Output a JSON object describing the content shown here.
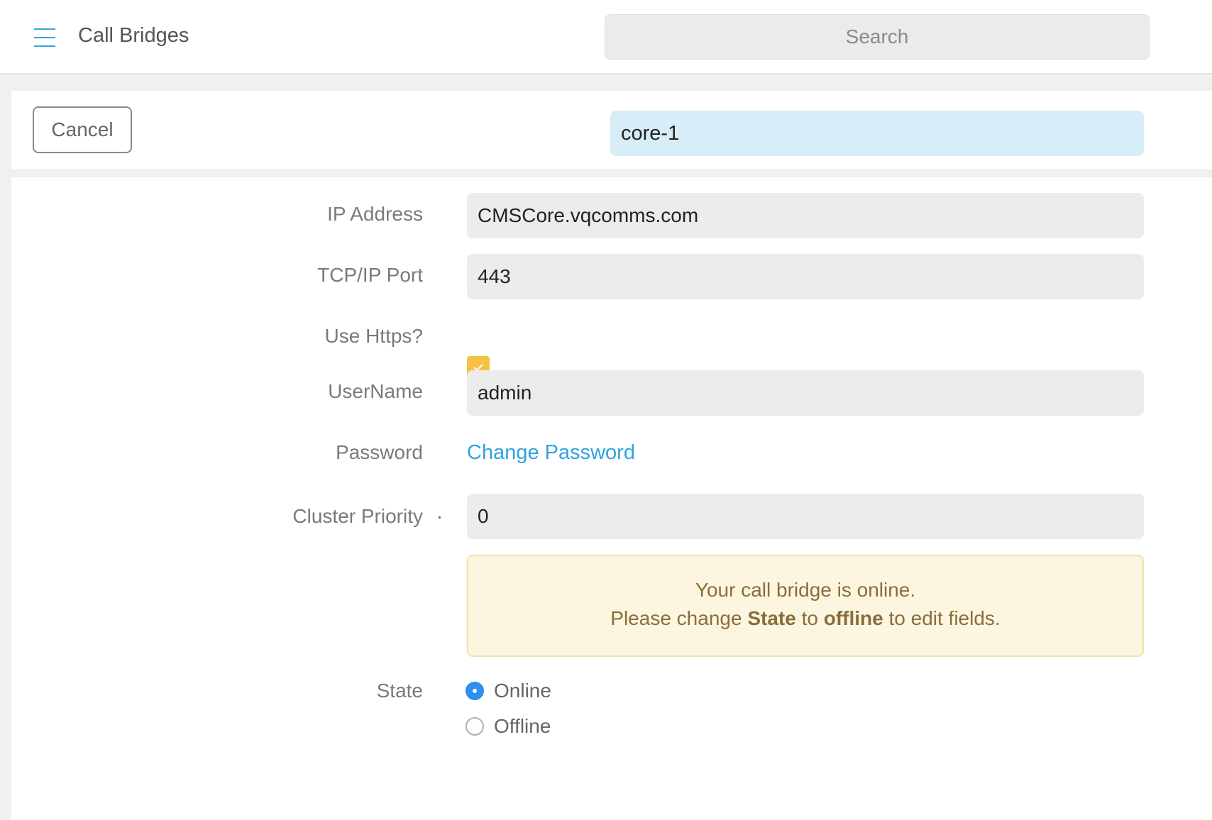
{
  "header": {
    "menu_icon": "hamburger-menu-icon",
    "title": "Call Bridges",
    "search_placeholder": "Search"
  },
  "actions": {
    "cancel_label": "Cancel",
    "name_value": "core-1"
  },
  "form": {
    "ip_address": {
      "label": "IP Address",
      "value": "CMSCore.vqcomms.com"
    },
    "tcp_port": {
      "label": "TCP/IP Port",
      "value": "443"
    },
    "use_https": {
      "label": "Use Https?",
      "checked": true
    },
    "username": {
      "label": "UserName",
      "value": "admin"
    },
    "password": {
      "label": "Password",
      "link": "Change Password"
    },
    "cluster_priority": {
      "label": "Cluster Priority",
      "value": "0"
    },
    "alert": {
      "line1": "Your call bridge is online.",
      "line2_pre": "Please change ",
      "line2_state": "State",
      "line2_mid": " to ",
      "line2_offline": "offline",
      "line2_post": " to edit fields."
    },
    "state": {
      "label": "State",
      "options": [
        {
          "label": "Online",
          "selected": true
        },
        {
          "label": "Offline",
          "selected": false
        }
      ]
    }
  },
  "colors": {
    "accent": "#39a5dc",
    "checkbox": "#f5c242",
    "radio_selected": "#2e8ff0",
    "alert_bg": "#fcf6e0",
    "alert_text": "#8a6d3b"
  }
}
